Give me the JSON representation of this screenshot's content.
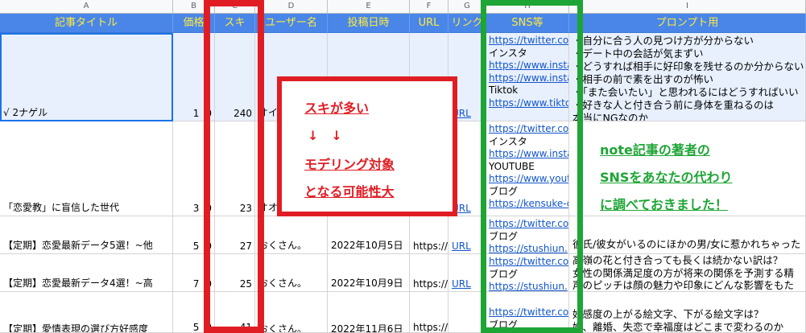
{
  "columns": [
    "A",
    "B",
    "C",
    "D",
    "E",
    "F",
    "G",
    "H",
    "I"
  ],
  "headers": {
    "title": "記事タイトル",
    "price": "価格",
    "likes": "スキ",
    "user": "ユーザー名",
    "date": "投稿日時",
    "url": "URL",
    "link": "リンク",
    "sns": "SNS等",
    "prompt": "プロンプト用"
  },
  "rows": [
    {
      "title": "√ 2ナゲル",
      "price": "1",
      "price_tail": "0",
      "likes": "240",
      "user": "オイ",
      "date": "",
      "url": "",
      "link": "URL",
      "sns": [
        "https://twitter.com",
        "インスタ",
        "https://www.insta",
        "https://www.insta",
        "Tiktok",
        "https://www.tiktok"
      ],
      "prompt": [
        "・自分に合う人の見つけ方が分からない",
        "・デート中の会話が気まずい",
        "・どうすれば相手に好印象を残せるのか分からない",
        "・相手の前で素を出すのが怖い",
        "・「また会いたい」と思われるにはどうすればいい",
        "・好きな人と付き合う前に身体を重ねるのは",
        "本当にNGなのか"
      ]
    },
    {
      "title": "「恋愛教」に盲信した世代",
      "price": "3",
      "price_tail": "0",
      "likes": "23",
      "user": "オオ",
      "date": "",
      "url": "",
      "link": "URL",
      "sns": [
        "https://twitter.com",
        "インスタ",
        "https://www.insta",
        "YOUTUBE",
        "https://www.yout",
        "ブログ",
        "https://kensuke-c"
      ],
      "prompt": []
    },
    {
      "title": "【定期】恋愛最新データ5選！~他",
      "price": "5",
      "price_tail": "0",
      "likes": "27",
      "user": "おくさん。",
      "date": "2022年10月5日",
      "url": "https://",
      "link": "URL",
      "sns": [
        "https://twitter.com",
        "ブログ",
        "https://stushiun."
      ],
      "prompt": [
        "彼氏/彼女がいるのにほかの男/女に惹かれちゃった"
      ]
    },
    {
      "title": "【定期】恋愛最新データ4選！~高",
      "price": "7",
      "price_tail": "0",
      "likes": "25",
      "user": "おくさん。",
      "date": "2022年10月9日",
      "url": "https://",
      "link": "URL",
      "sns": [
        "https://twitter.com",
        "ブログ",
        "https://stushiun."
      ],
      "prompt": [
        "高嶺の花と付き合っても長くは続かない訳は？",
        "女性の関係満足度の方が将来の関係を予測する精",
        "声のピッチは顔の魅力や印象にどんな影響をもた"
      ]
    },
    {
      "title": "【定期】愛情表現の選び方好感度",
      "price": "5",
      "price_tail": "0",
      "likes": "41",
      "user": "おくさん。",
      "date": "2022年11月6日",
      "url": "https://",
      "link": "URL",
      "sns": [
        "https://twitter.com",
        "ブログ"
      ],
      "prompt": [
        "好感度の上がる絵文字、下がる絵文字は？",
        "婚、離婚、失恋で幸福度はどこまで変わるのか"
      ]
    }
  ],
  "callout": {
    "line1": "スキが多い",
    "line2": "↓　↓",
    "line3": "モデリング対象",
    "line4": "となる可能性大"
  },
  "note": {
    "line1": "note記事の著者の",
    "line2": "SNSをあなたの代わり",
    "line3": "に調べておきました！"
  },
  "colors": {
    "header_bg": "#4a86e8",
    "header_text": "#ffeb3b",
    "red": "#e11d24",
    "green": "#1ea535",
    "link": "#1155cc"
  }
}
